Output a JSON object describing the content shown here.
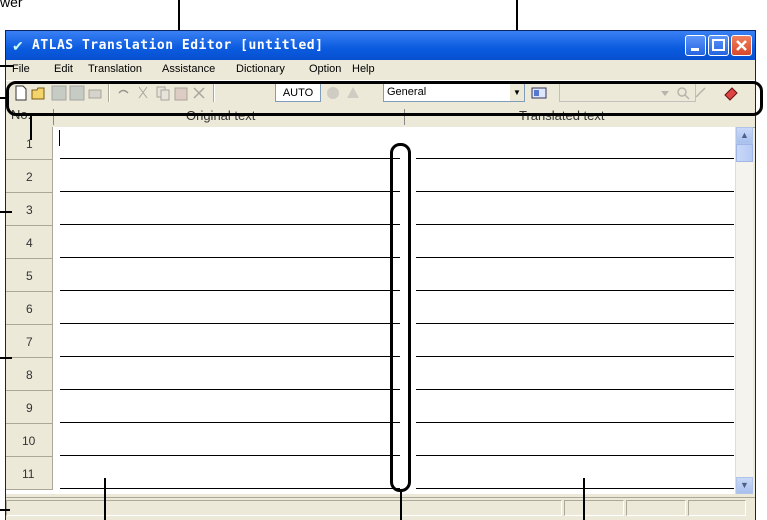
{
  "callout": {
    "label": "wer"
  },
  "window": {
    "title": "ATLAS Translation Editor  [untitled]"
  },
  "menu": [
    "File",
    "Edit",
    "Translation",
    "Assistance",
    "Dictionary",
    "Option",
    "Help"
  ],
  "toolbar": {
    "auto_label": "AUTO",
    "domain_value": "General"
  },
  "grid": {
    "header": {
      "no": "No.",
      "original": "Original text",
      "translated": "Translated text"
    },
    "rows": [
      "1",
      "2",
      "3",
      "4",
      "5",
      "6",
      "7",
      "8",
      "9",
      "10",
      "11"
    ]
  }
}
